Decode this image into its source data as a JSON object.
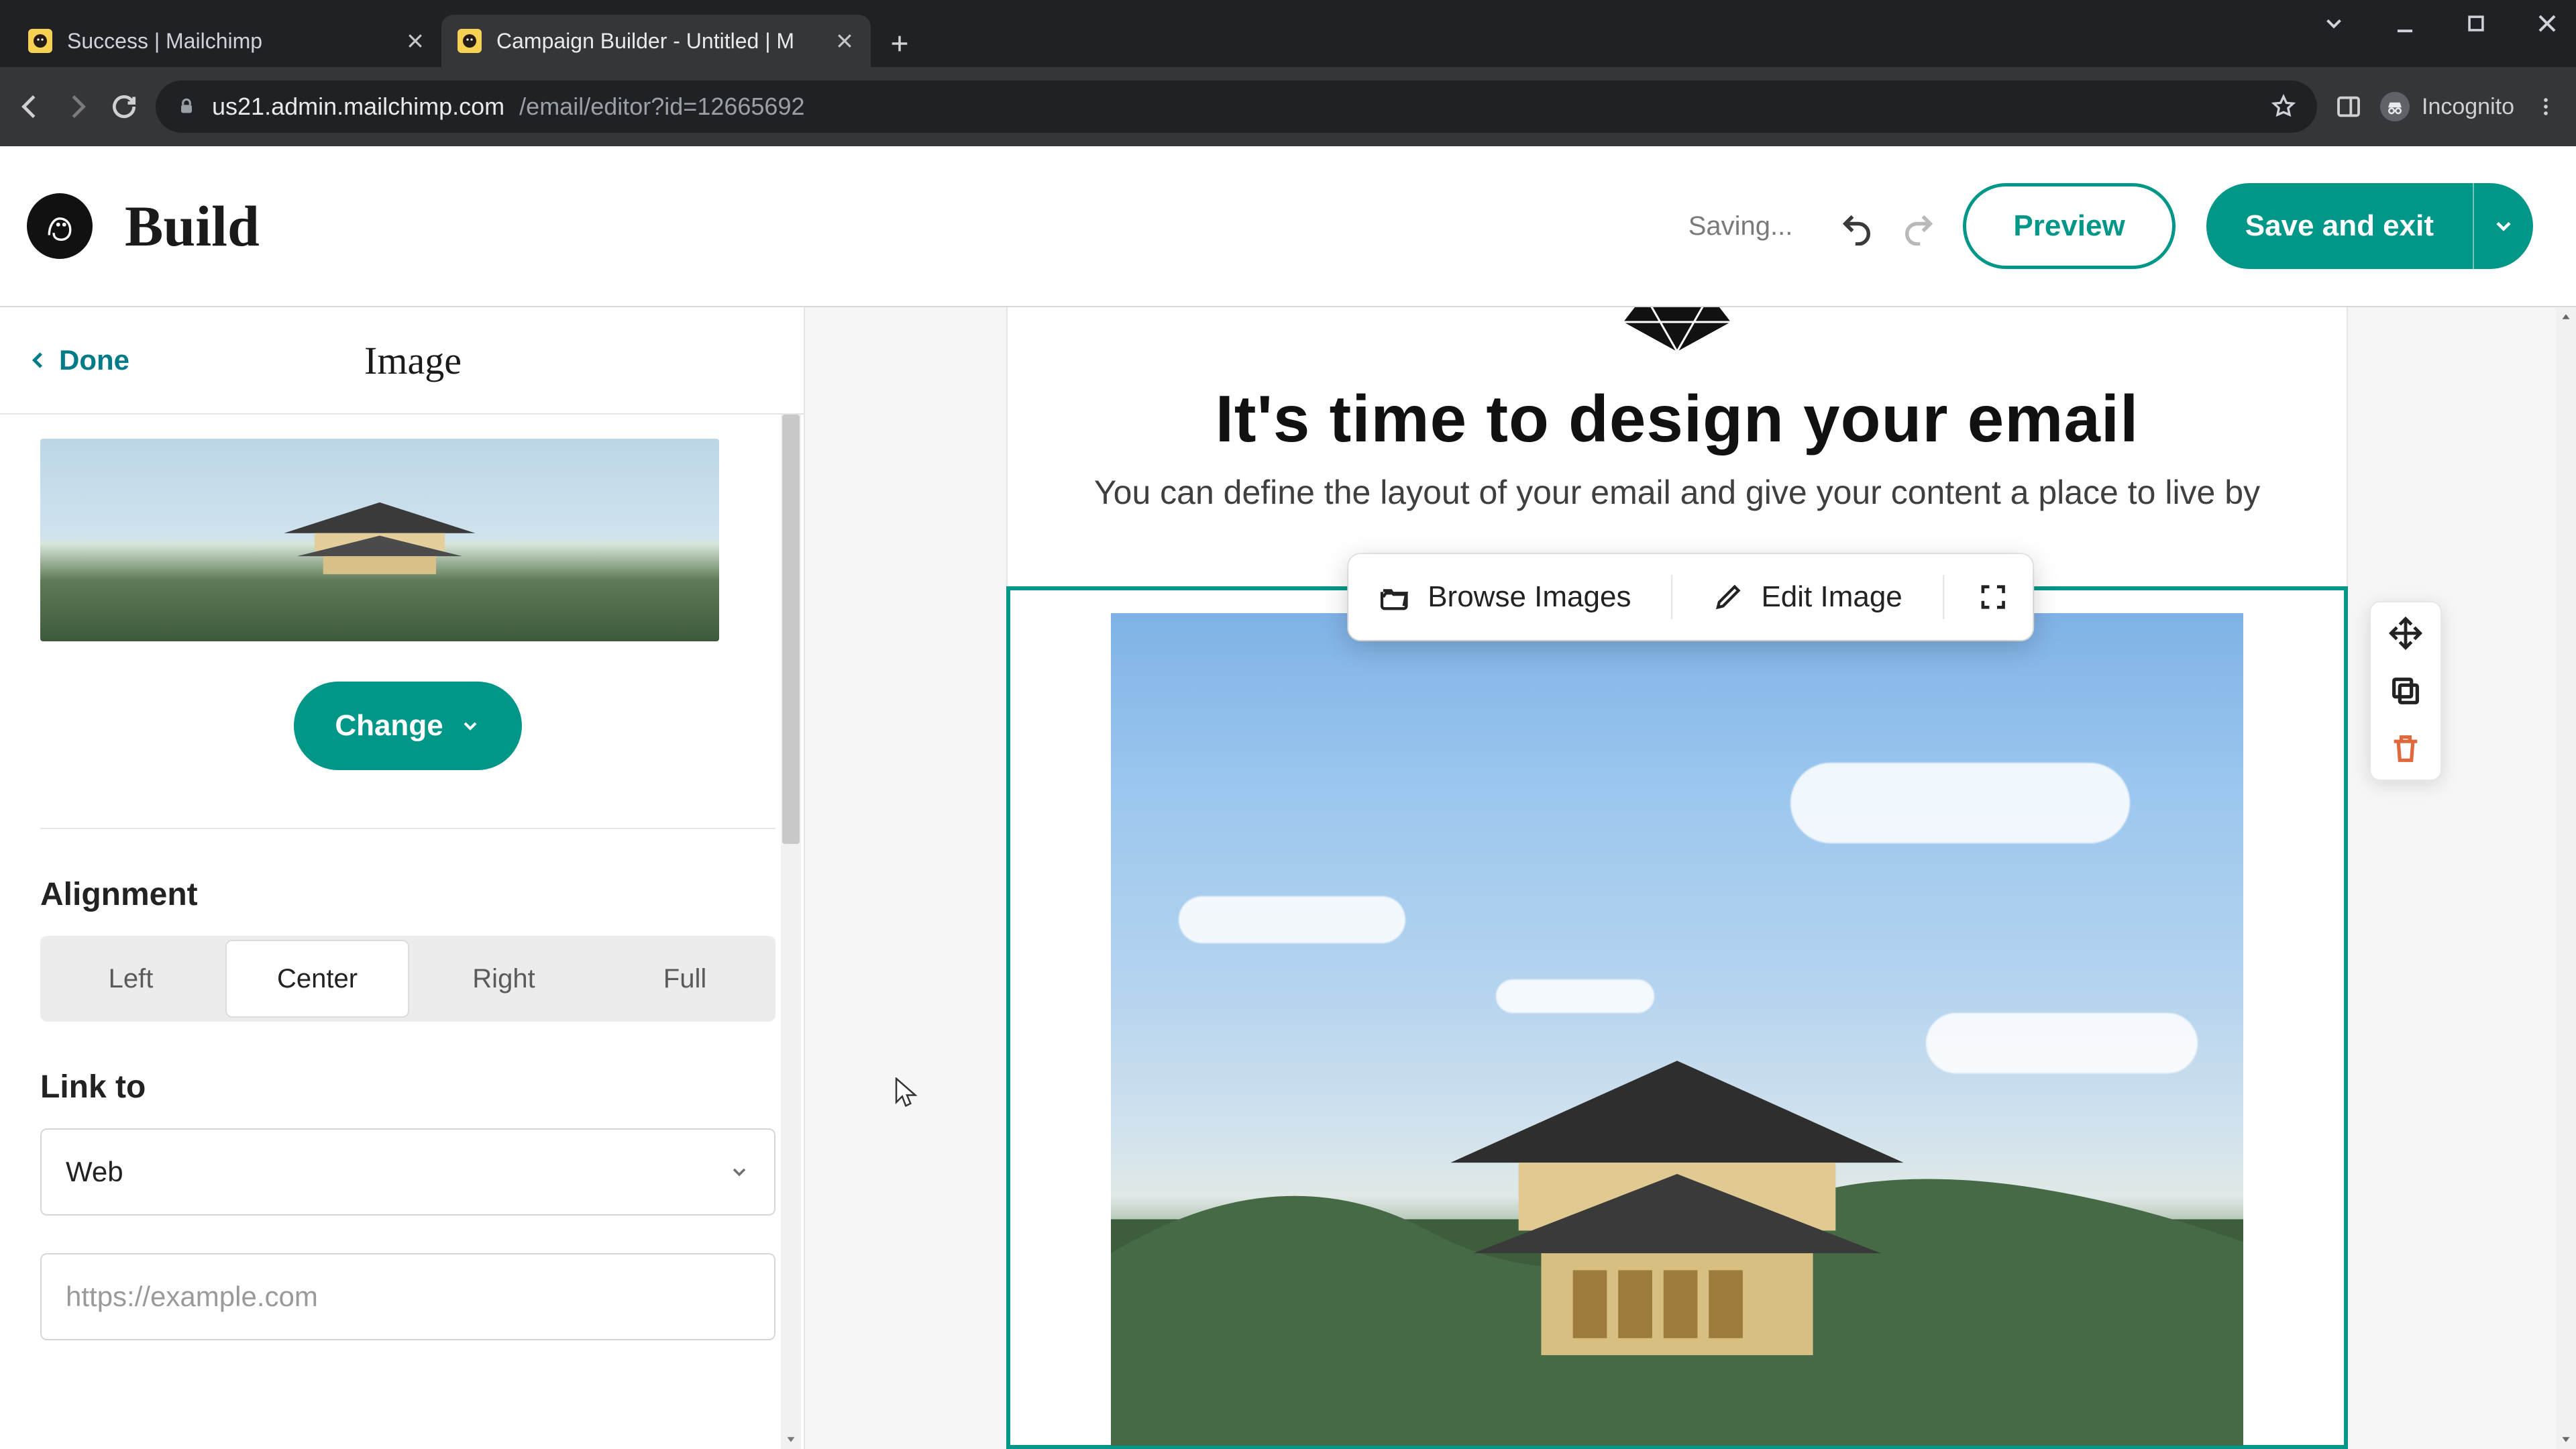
{
  "browser": {
    "tabs": [
      {
        "title": "Success | Mailchimp",
        "active": false
      },
      {
        "title": "Campaign Builder - Untitled | M",
        "active": true
      }
    ],
    "url_host": "us21.admin.mailchimp.com",
    "url_path": "/email/editor?id=12665692",
    "incognito_label": "Incognito"
  },
  "header": {
    "title": "Build",
    "saving": "Saving...",
    "preview": "Preview",
    "save": "Save and exit"
  },
  "sidebar": {
    "done": "Done",
    "panel_title": "Image",
    "change": "Change",
    "alignment": {
      "heading": "Alignment",
      "options": [
        "Left",
        "Center",
        "Right",
        "Full"
      ],
      "selected": "Center"
    },
    "link": {
      "heading": "Link to",
      "value": "Web",
      "placeholder": "https://example.com"
    }
  },
  "canvas": {
    "headline": "It's time to design your email",
    "subline": "You can define the layout of your email and give your content a place to live by",
    "toolbar": {
      "browse": "Browse Images",
      "edit": "Edit Image"
    }
  }
}
